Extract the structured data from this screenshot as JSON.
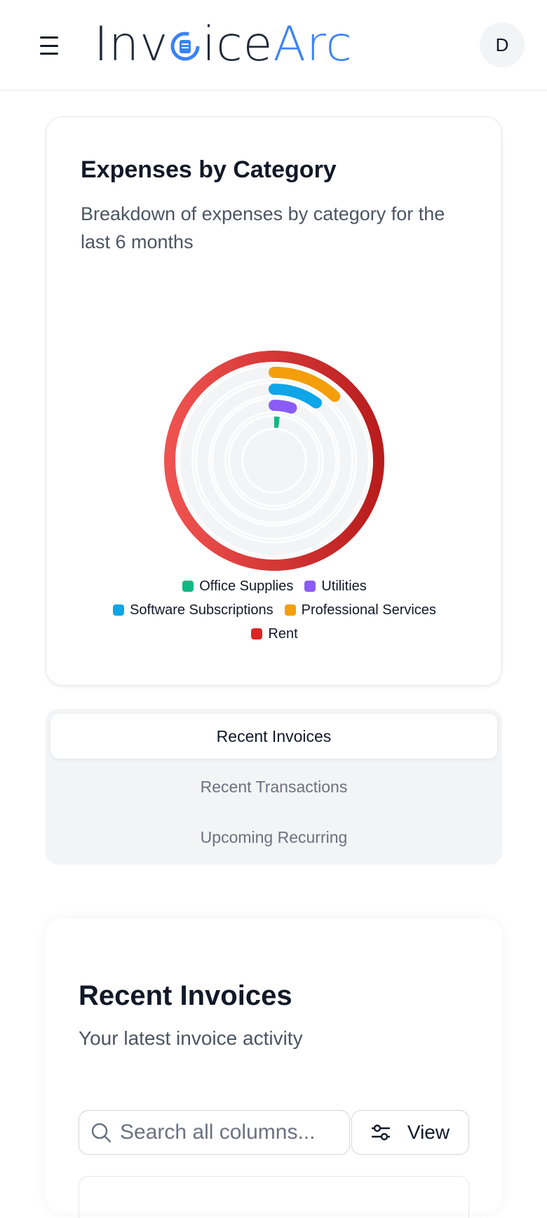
{
  "header": {
    "logo_part1": "Inv",
    "logo_part2": "ice",
    "logo_part3": "Arc",
    "avatar_initial": "D"
  },
  "expenses_card": {
    "title": "Expenses by Category",
    "subtitle": "Breakdown of expenses by category for the last 6 months"
  },
  "chart_data": {
    "type": "radial-bar",
    "title": "",
    "categories": [
      "Office Supplies",
      "Utilities",
      "Software Subscriptions",
      "Professional Services",
      "Rent"
    ],
    "values": [
      2,
      5,
      10,
      12,
      100
    ],
    "unit": "percent of max",
    "colors": [
      "#10b981",
      "#8b5cf6",
      "#0ea5e9",
      "#f59e0b",
      "#dc2626"
    ],
    "track_color": "#f3f4f6",
    "legend_position": "bottom"
  },
  "legend": {
    "rows": [
      [
        {
          "label": "Office Supplies",
          "color": "#10b981"
        },
        {
          "label": "Utilities",
          "color": "#8b5cf6"
        }
      ],
      [
        {
          "label": "Software Subscriptions",
          "color": "#0ea5e9"
        },
        {
          "label": "Professional Services",
          "color": "#f59e0b"
        }
      ],
      [
        {
          "label": "Rent",
          "color": "#dc2626"
        }
      ]
    ]
  },
  "tabs": [
    {
      "label": "Recent Invoices",
      "active": true
    },
    {
      "label": "Recent Transactions",
      "active": false
    },
    {
      "label": "Upcoming Recurring",
      "active": false
    }
  ],
  "invoices": {
    "title": "Recent Invoices",
    "subtitle": "Your latest invoice activity",
    "search_placeholder": "Search all columns...",
    "view_label": "View"
  }
}
